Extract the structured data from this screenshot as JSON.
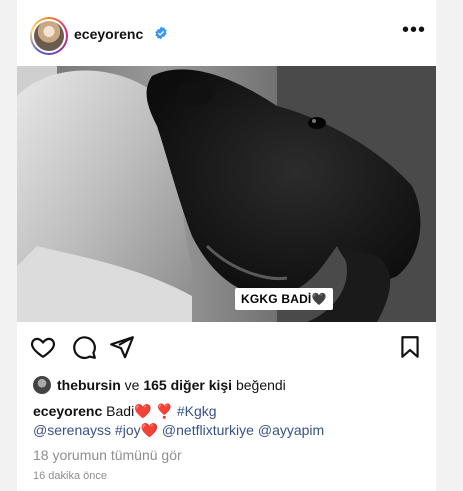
{
  "post": {
    "username": "eceyorenc",
    "more_label": "•••",
    "sticker_text": "KGKG BADİ🖤",
    "likes": {
      "first_user": "thebursin",
      "connector": " ve ",
      "others": "165 diğer kişi",
      "suffix": " beğendi"
    },
    "caption": {
      "username": "eceyorenc",
      "text": " Badi",
      "emoji1": "❤️",
      "emoji2": " ❣️ ",
      "hashtag1": "#Kgkg",
      "mention1": "@serenayss",
      "hashtag2": " #joy",
      "emoji3": "❤️",
      "mention2": " @netflixturkiye",
      "mention3": " @ayyapim"
    },
    "view_comments": "18 yorumun tümünü gör",
    "timestamp": "16 dakika önce"
  },
  "colors": {
    "verified": "#3897f0",
    "link": "#385185",
    "muted": "#8e8e8e"
  },
  "icons": [
    "heart-icon",
    "comment-icon",
    "share-icon",
    "bookmark-icon",
    "verified-icon",
    "more-icon"
  ]
}
